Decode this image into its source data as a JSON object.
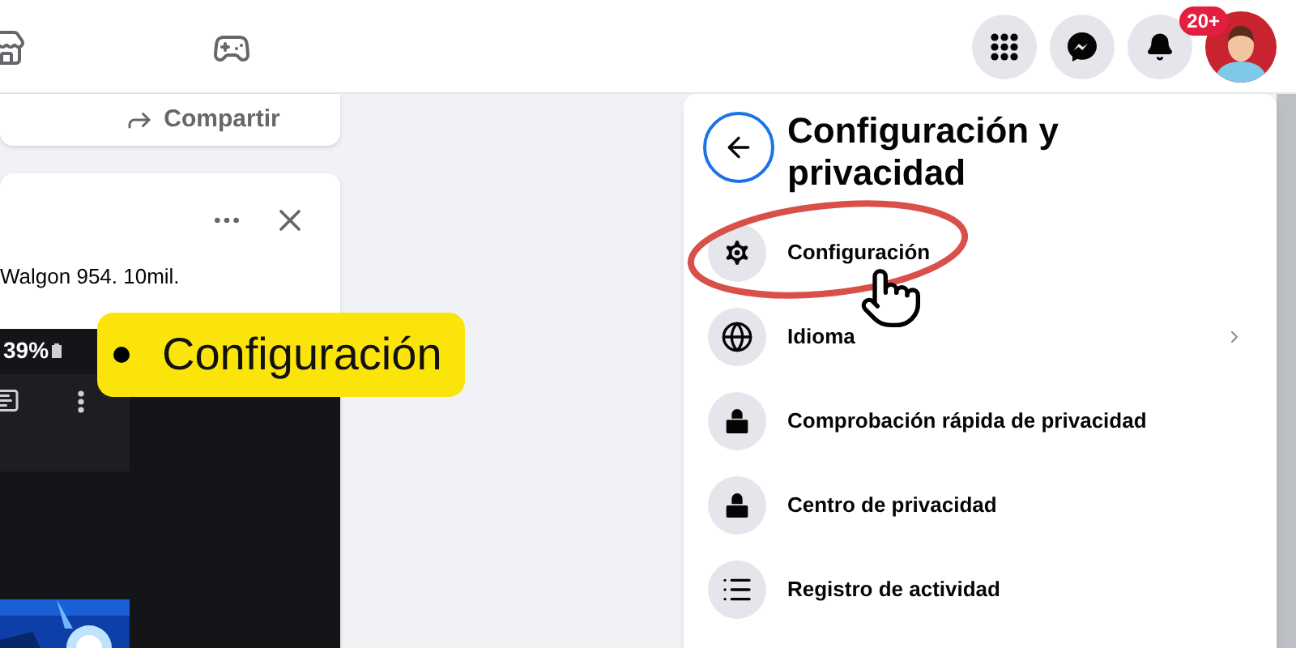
{
  "top_bar": {
    "notification_badge": "20+"
  },
  "share_card": {
    "label": "Compartir"
  },
  "post": {
    "text": "Walgon 954. 10mil.",
    "phone_screenshot": {
      "battery": "39%"
    }
  },
  "callout": {
    "label": "Configuración"
  },
  "menu": {
    "title": "Configuración y privacidad",
    "items": [
      {
        "label": "Configuración",
        "has_submenu": false,
        "circled": true
      },
      {
        "label": "Idioma",
        "has_submenu": true,
        "circled": false
      },
      {
        "label": "Comprobación rápida de privacidad",
        "has_submenu": false,
        "circled": false
      },
      {
        "label": "Centro de privacidad",
        "has_submenu": false,
        "circled": false
      },
      {
        "label": "Registro de actividad",
        "has_submenu": false,
        "circled": false
      }
    ]
  }
}
